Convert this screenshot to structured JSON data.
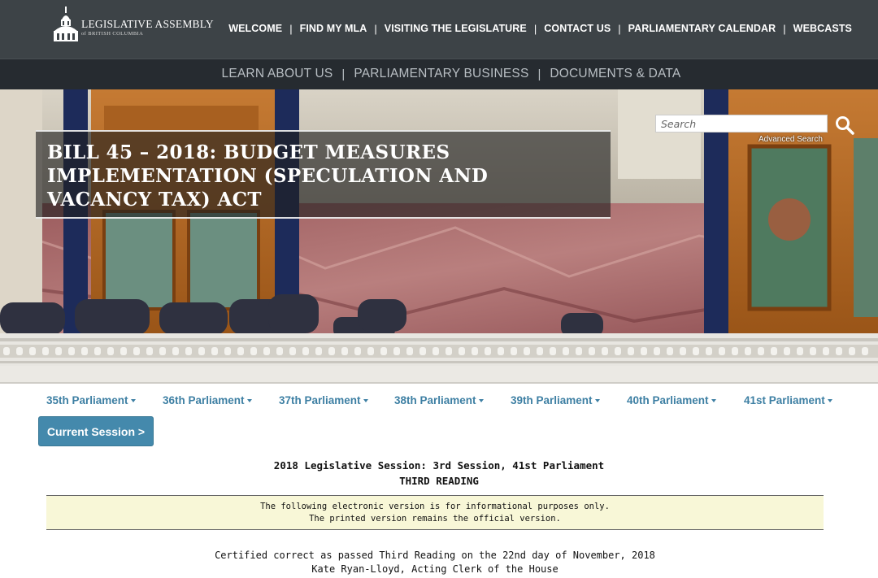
{
  "site": {
    "logo_title": "LEGISLATIVE ASSEMBLY",
    "logo_subtitle": "of BRITISH COLUMBIA"
  },
  "top_nav": {
    "items": [
      "WELCOME",
      "FIND MY MLA",
      "VISITING THE LEGISLATURE",
      "CONTACT US",
      "PARLIAMENTARY CALENDAR",
      "WEBCASTS"
    ],
    "separator": "|"
  },
  "sub_nav": {
    "items": [
      "LEARN ABOUT US",
      "PARLIAMENTARY BUSINESS",
      "DOCUMENTS & DATA"
    ],
    "separator": "|"
  },
  "hero": {
    "title": "BILL 45 – 2018: BUDGET MEASURES IMPLEMENTATION (SPECULATION AND VACANCY TAX) ACT"
  },
  "search": {
    "placeholder": "Search",
    "value": "",
    "icon": "search-icon",
    "advanced_label": "Advanced Search"
  },
  "parliaments": {
    "items": [
      "35th Parliament",
      "36th Parliament",
      "37th Parliament",
      "38th Parliament",
      "39th Parliament",
      "40th Parliament",
      "41st Parliament"
    ],
    "current_button": "Current Session >"
  },
  "bill": {
    "session_line": "2018 Legislative Session: 3rd Session, 41st Parliament",
    "reading": "THIRD READING",
    "notice_line1": "The following electronic version is for informational purposes only.",
    "notice_line2": "The printed version remains the official version.",
    "certified_line": "Certified correct as passed Third Reading on the 22nd day of November, 2018",
    "clerk_line": "Kate Ryan-Lloyd, Acting Clerk of the House"
  },
  "colors": {
    "topbar": "#3d4347",
    "subbar": "#262b30",
    "link_blue": "#3d7fa3",
    "button_blue": "#4489ac",
    "notice_bg": "#f8f7d7"
  }
}
